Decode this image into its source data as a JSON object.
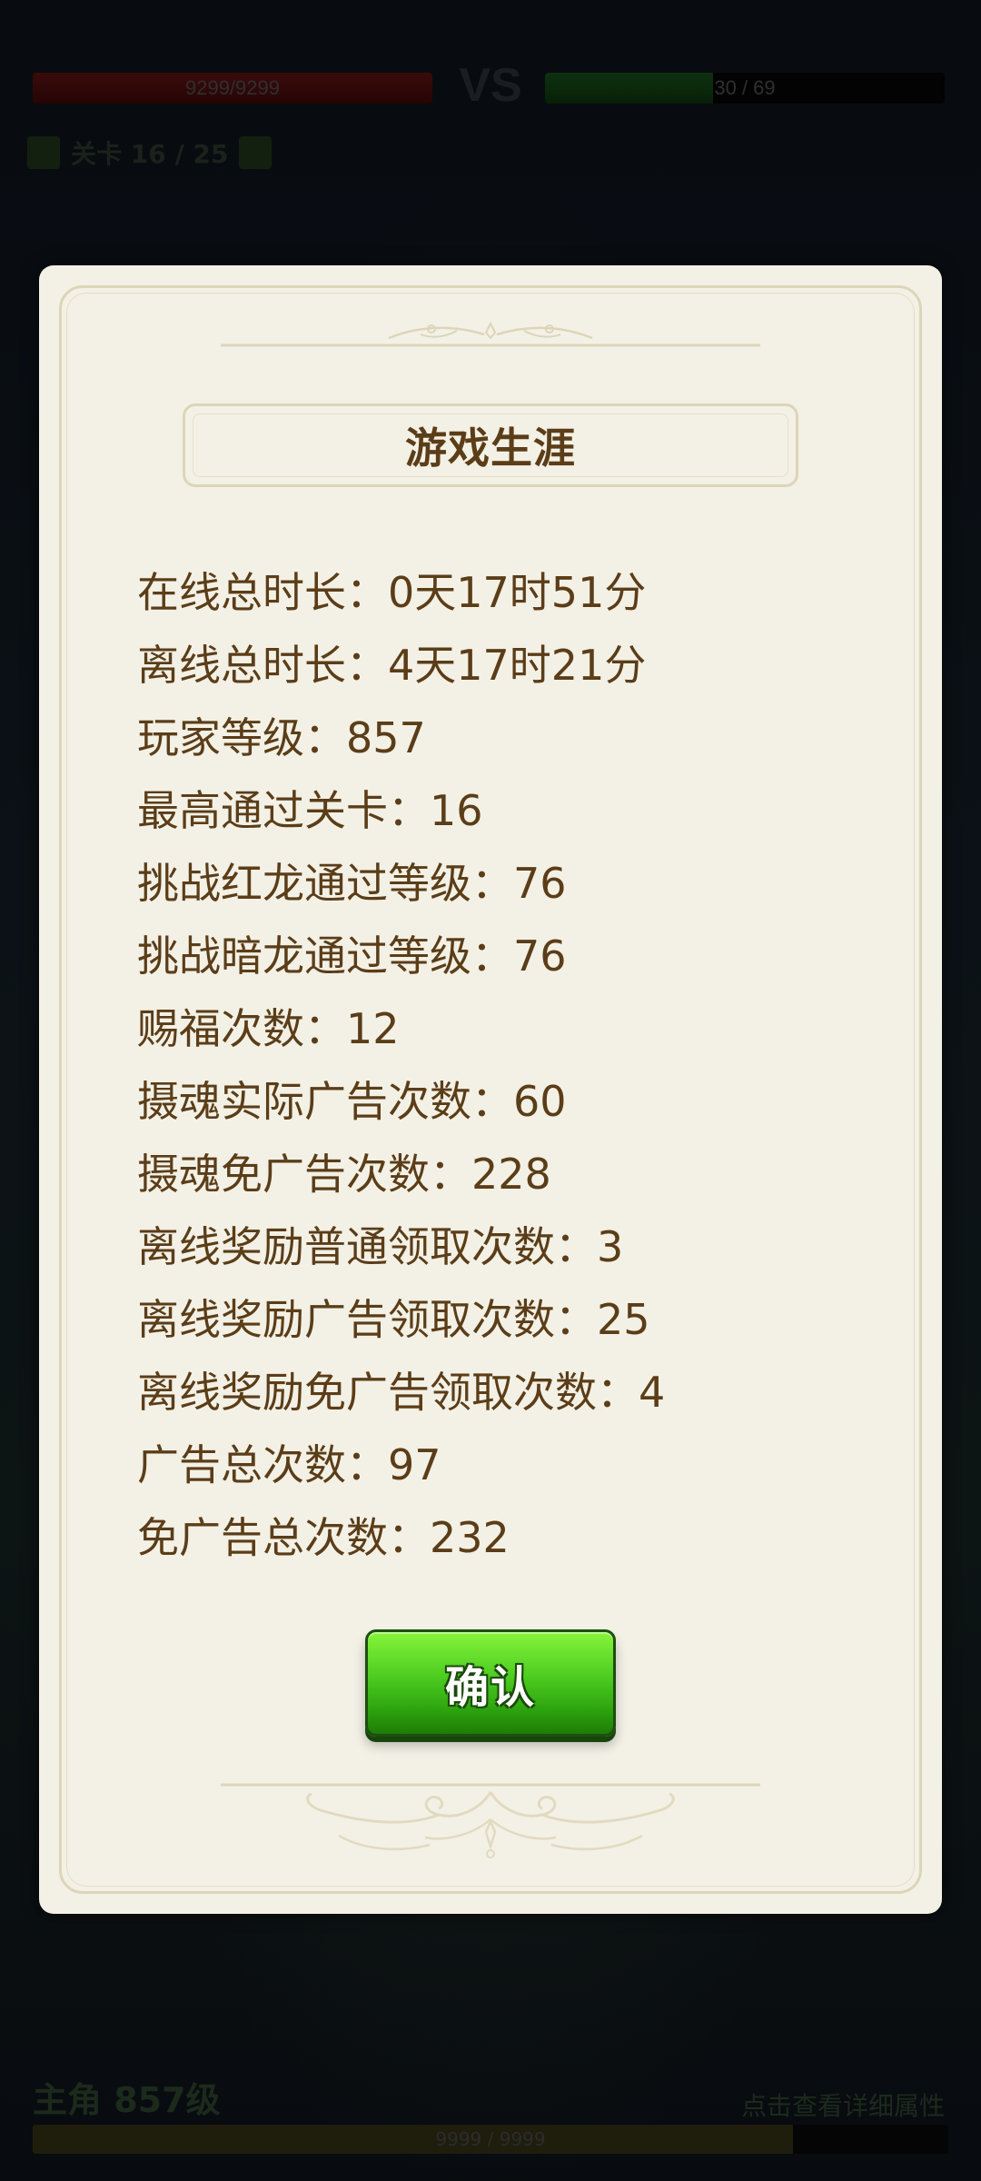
{
  "background": {
    "player_hp_text": "9299/9299",
    "vs_label": "VS",
    "enemy_hp_text": "30 / 69",
    "stage_text": "关卡 16 / 25",
    "hero_title": "主角 857级",
    "hero_right_text": "点击查看详细属性",
    "exp_text": "9999 / 9999"
  },
  "modal": {
    "title": "游戏生涯",
    "stats": [
      "在线总时长：0天17时51分",
      "离线总时长：4天17时21分",
      "玩家等级：857",
      "最高通过关卡：16",
      "挑战红龙通过等级：76",
      "挑战暗龙通过等级：76",
      "赐福次数：12",
      "摄魂实际广告次数：60",
      "摄魂免广告次数：228",
      "离线奖励普通领取次数：3",
      "离线奖励广告领取次数：25",
      "离线奖励免广告领取次数：4",
      "广告总次数：97",
      "免广告总次数：232"
    ],
    "confirm_label": "确认"
  },
  "colors": {
    "modal_bg": "#f3f1e6",
    "text_brown": "#5b3d18",
    "frame_border": "#ddd5b8",
    "button_green": "#4ccb20"
  },
  "icons": {
    "top_ornament": "ornament-divider-icon",
    "bottom_ornament": "ornament-flourish-icon"
  }
}
